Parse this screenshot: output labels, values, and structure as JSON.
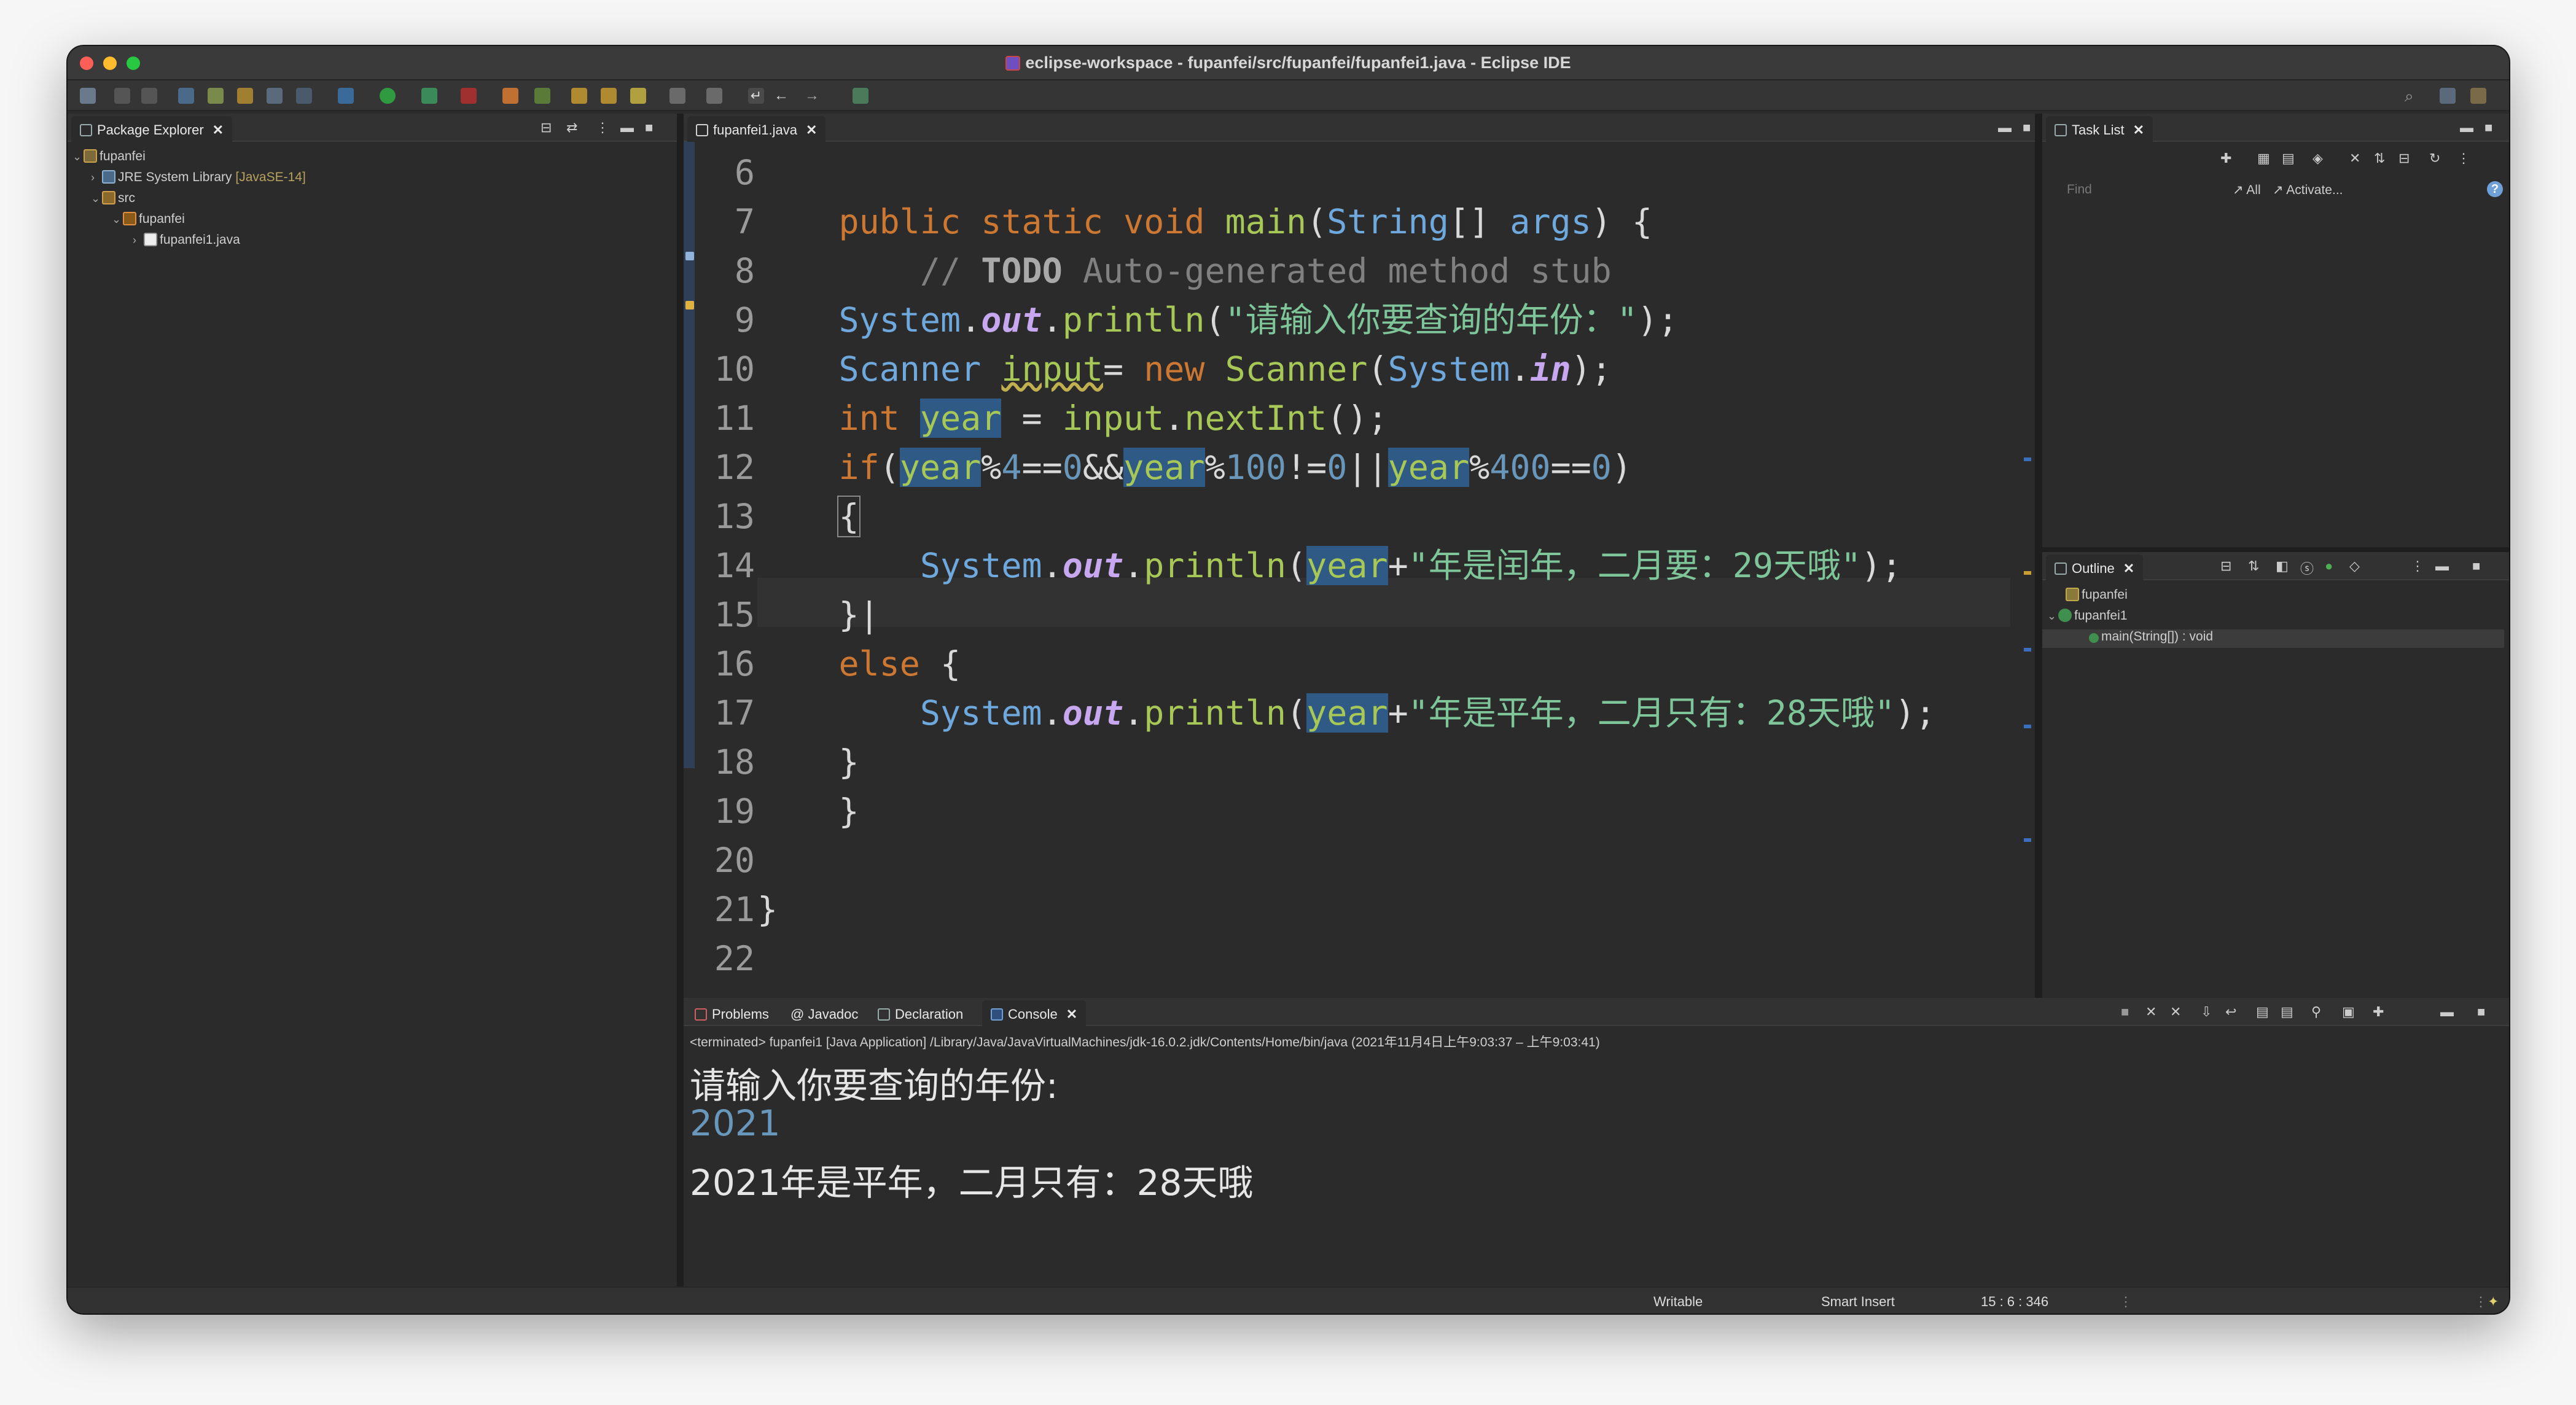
{
  "window": {
    "title": "eclipse-workspace - fupanfei/src/fupanfei/fupanfei1.java - Eclipse IDE"
  },
  "package_explorer": {
    "tab_label": "Package Explorer",
    "tree": [
      {
        "label": "fupanfei",
        "icon": "project-icon"
      },
      {
        "label": "JRE System Library",
        "suffix": "[JavaSE-14]",
        "icon": "library-icon"
      },
      {
        "label": "src",
        "icon": "source-folder-icon"
      },
      {
        "label": "fupanfei",
        "icon": "package-icon"
      },
      {
        "label": "fupanfei1.java",
        "icon": "java-file-icon"
      }
    ]
  },
  "editor": {
    "tab_label": "fupanfei1.java",
    "line_numbers": [
      "6",
      "7",
      "8",
      "9",
      "10",
      "11",
      "12",
      "13",
      "14",
      "15",
      "16",
      "17",
      "18",
      "19",
      "20",
      "21",
      "22"
    ]
  },
  "task_list": {
    "tab_label": "Task List",
    "find_placeholder": "Find",
    "all_label": "All",
    "activate_label": "Activate..."
  },
  "outline": {
    "tab_label": "Outline",
    "items": [
      {
        "label": "fupanfei",
        "icon": "package-icon"
      },
      {
        "label": "fupanfei1",
        "icon": "class-icon"
      },
      {
        "label": "main(String[]) : void",
        "icon": "method-icon"
      }
    ]
  },
  "bottom_tabs": {
    "problems": "Problems",
    "javadoc": "Javadoc",
    "declaration": "Declaration",
    "console": "Console"
  },
  "console": {
    "status": "<terminated> fupanfei1 [Java Application] /Library/Java/JavaVirtualMachines/jdk-16.0.2.jdk/Contents/Home/bin/java  (2021年11月4日上午9:03:37 – 上午9:03:41)",
    "prompt": "请输入你要查询的年份:",
    "input": "2021",
    "output": "2021年是平年，二月只有：28天哦"
  },
  "status_bar": {
    "writable": "Writable",
    "insert_mode": "Smart Insert",
    "position": "15 : 6 : 346"
  }
}
